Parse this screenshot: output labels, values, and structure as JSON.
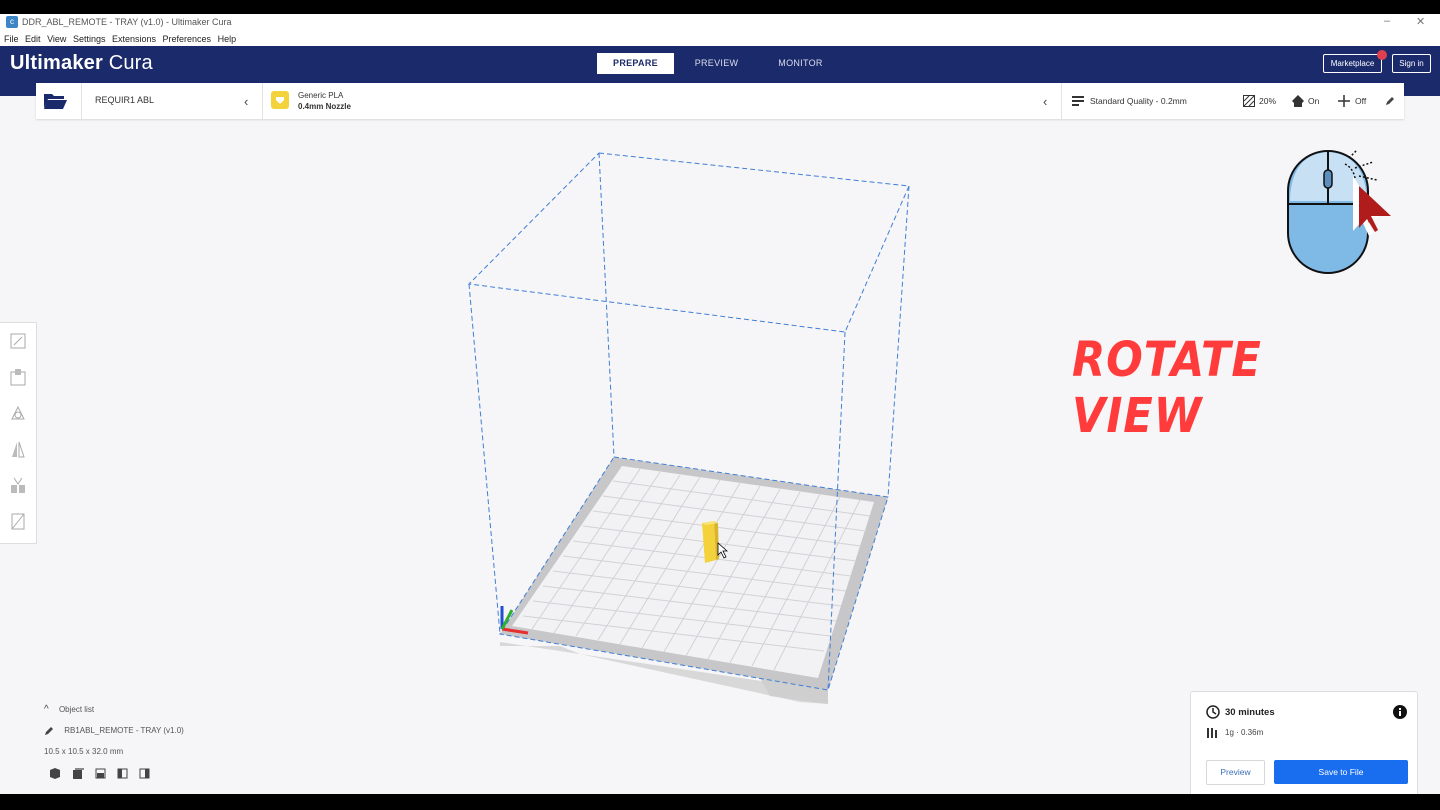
{
  "window": {
    "title": "DDR_ABL_REMOTE - TRAY (v1.0) - Ultimaker Cura"
  },
  "menu": [
    "File",
    "Edit",
    "View",
    "Settings",
    "Extensions",
    "Preferences",
    "Help"
  ],
  "header": {
    "brand_bold": "Ultimaker",
    "brand_light": " Cura",
    "tabs": [
      "PREPARE",
      "PREVIEW",
      "MONITOR"
    ],
    "active_tab": "PREPARE",
    "marketplace_label": "Marketplace",
    "signin_label": "Sign in"
  },
  "stage": {
    "printer_name": "REQUIR1 ABL",
    "material_name": "Generic PLA",
    "nozzle": "0.4mm Nozzle",
    "quality": "Standard Quality - 0.2mm",
    "infill": "20%",
    "support": "On",
    "adhesion": "Off"
  },
  "overlay": {
    "rotate_label": "ROTATE VIEW"
  },
  "object": {
    "list_label": "Object list",
    "name": "RB1ABL_REMOTE - TRAY (v1.0)",
    "dimensions": "10.5 x 10.5 x 32.0 mm"
  },
  "print": {
    "time": "30 minutes",
    "material": "1g · 0.36m",
    "preview_label": "Preview",
    "save_label": "Save to File"
  },
  "colors": {
    "header_bg": "#1a2a6b",
    "accent_blue": "#196ef0",
    "overlay_red": "#ff3b3b",
    "model_yellow": "#f4d23c"
  },
  "icons": [
    "cura-app-icon",
    "folder-open-icon",
    "material-icon",
    "quality-icon",
    "infill-icon",
    "support-icon",
    "adhesion-icon",
    "pencil-icon",
    "move-icon",
    "scale-icon",
    "rotate-icon",
    "mirror-icon",
    "per-model-settings-icon",
    "support-blocker-icon",
    "clock-icon",
    "filament-icon",
    "info-icon",
    "mouse-icon",
    "chevron-left-icon",
    "chevron-up-icon"
  ]
}
